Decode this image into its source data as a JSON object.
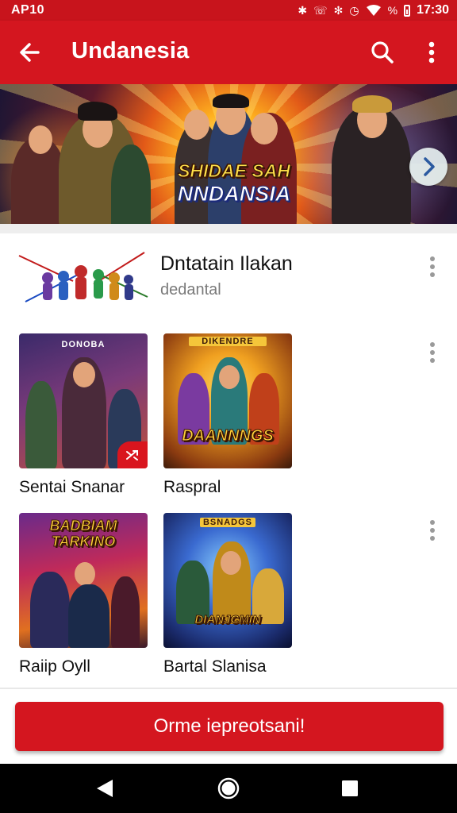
{
  "status_bar": {
    "left_text": "AP10",
    "battery": "%",
    "time": "17:30",
    "icons": [
      "bluetooth-icon",
      "vibrate-icon",
      "nfc-icon",
      "alarm-icon",
      "wifi-icon",
      "battery-icon"
    ]
  },
  "app_bar": {
    "title": "Undanesia",
    "back_icon": "arrow-left-icon",
    "search_icon": "search-icon",
    "more_icon": "more-vertical-icon"
  },
  "banner": {
    "title_line1": "SHIDAE SAH",
    "title_line2": "NNDANSIA",
    "next_icon": "chevron-right-icon"
  },
  "featured": {
    "title": "Dntatain Ilakan",
    "subtitle": "dedantal"
  },
  "grid": [
    {
      "label": "Sentai Snanar",
      "art_tag": "DONOBA",
      "art_title": "",
      "has_badge": true
    },
    {
      "label": "Raspral",
      "art_tag": "DIKENDRE",
      "art_title": "DAANNNGS",
      "has_badge": false
    },
    {
      "label": "Raiip Oyll",
      "art_tag": "",
      "art_title": "BADBIAM TARKINO",
      "has_badge": false
    },
    {
      "label": "Bartal Slanisa",
      "art_tag": "BSNADGS",
      "art_title": "DIANJCMIN",
      "has_badge": false
    }
  ],
  "cta": {
    "label": "Orme iepreotsani!"
  },
  "nav_bar": {
    "icons": [
      "back-triangle-icon",
      "home-circle-icon",
      "recents-square-icon"
    ]
  },
  "colors": {
    "brand_red": "#d4161f",
    "status_red": "#c8141c"
  }
}
